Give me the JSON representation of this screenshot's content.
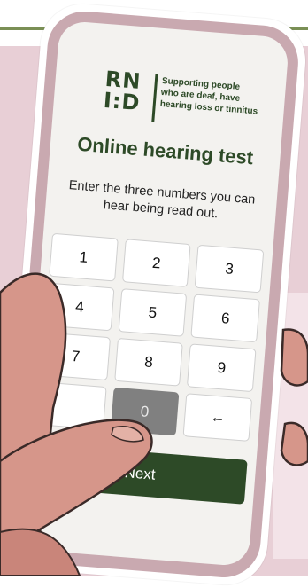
{
  "logo": {
    "mark_line1": "RN",
    "mark_line2": "I:D",
    "tagline_line1": "Supporting people",
    "tagline_line2": "who are deaf, have",
    "tagline_line3": "hearing loss or tinnitus"
  },
  "title": "Online hearing test",
  "subtitle": "Enter the three numbers you can hear being read out.",
  "keypad": {
    "keys": [
      "1",
      "2",
      "3",
      "4",
      "5",
      "6",
      "7",
      "8",
      "9",
      "",
      "0",
      "←"
    ]
  },
  "next_label": "Next",
  "colors": {
    "brand_green": "#2d4a27",
    "phone_body": "#c9a9b0",
    "background_pink": "#e8cfd6",
    "skin": "#d6968a"
  }
}
